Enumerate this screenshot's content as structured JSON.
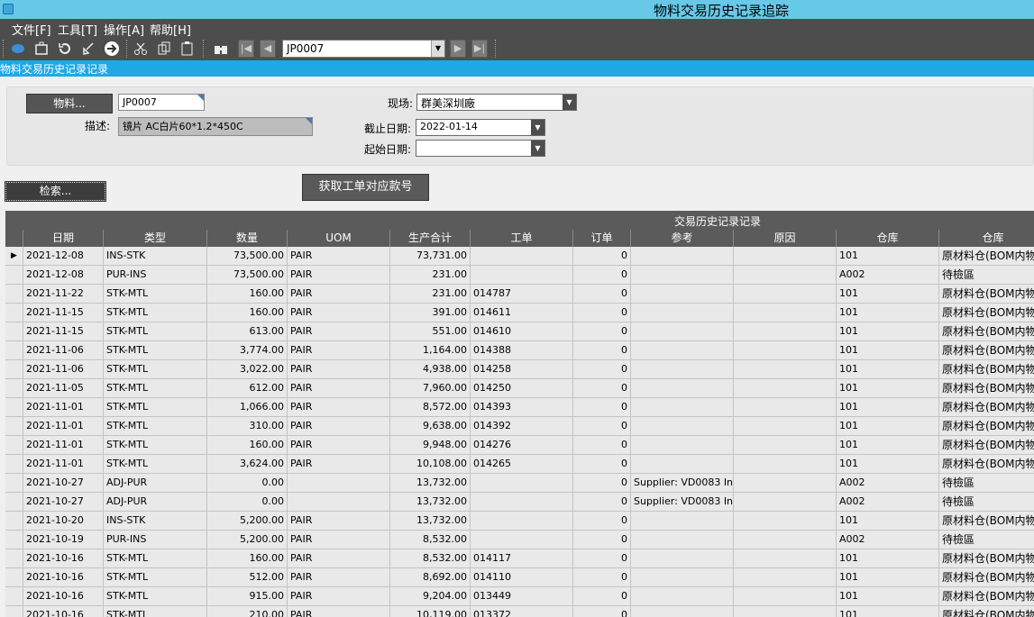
{
  "window": {
    "title": "物料交易历史记录追踪"
  },
  "menu": {
    "file": "文件[F]",
    "tools": "工具[T]",
    "operate": "操作[A]",
    "help": "帮助[H]"
  },
  "toolbar": {
    "combo_value": "JP0007"
  },
  "subtitle": "物料交易历史记录记录",
  "form": {
    "item_button": "物料...",
    "item_value": "JP0007",
    "desc_label": "描述:",
    "desc_value": "镜片 AC白片60*1.2*450C",
    "site_label": "现场:",
    "site_value": "群美深圳廠",
    "end_date_label": "截止日期:",
    "end_date_value": "2022-01-14",
    "start_date_label": "起始日期:",
    "start_date_value": "",
    "get_button": "获取工单对应款号",
    "search_button": "检索..."
  },
  "grid": {
    "title": "交易历史记录记录",
    "columns": [
      "日期",
      "类型",
      "数量",
      "UOM",
      "生产合计",
      "工单",
      "订单",
      "参考",
      "原因",
      "仓库",
      "仓库"
    ],
    "rows": [
      [
        "2021-12-08",
        "INS-STK",
        "73,500.00",
        "PAIR",
        "73,731.00",
        "",
        "0",
        "",
        "",
        "101",
        "原材料仓(BOM内物"
      ],
      [
        "2021-12-08",
        "PUR-INS",
        "73,500.00",
        "PAIR",
        "231.00",
        "",
        "0",
        "",
        "",
        "A002",
        "待檢區"
      ],
      [
        "2021-11-22",
        "STK-MTL",
        "160.00",
        "PAIR",
        "231.00",
        "014787",
        "0",
        "",
        "",
        "101",
        "原材料仓(BOM内物"
      ],
      [
        "2021-11-15",
        "STK-MTL",
        "160.00",
        "PAIR",
        "391.00",
        "014611",
        "0",
        "",
        "",
        "101",
        "原材料仓(BOM内物"
      ],
      [
        "2021-11-15",
        "STK-MTL",
        "613.00",
        "PAIR",
        "551.00",
        "014610",
        "0",
        "",
        "",
        "101",
        "原材料仓(BOM内物"
      ],
      [
        "2021-11-06",
        "STK-MTL",
        "3,774.00",
        "PAIR",
        "1,164.00",
        "014388",
        "0",
        "",
        "",
        "101",
        "原材料仓(BOM内物"
      ],
      [
        "2021-11-06",
        "STK-MTL",
        "3,022.00",
        "PAIR",
        "4,938.00",
        "014258",
        "0",
        "",
        "",
        "101",
        "原材料仓(BOM内物"
      ],
      [
        "2021-11-05",
        "STK-MTL",
        "612.00",
        "PAIR",
        "7,960.00",
        "014250",
        "0",
        "",
        "",
        "101",
        "原材料仓(BOM内物"
      ],
      [
        "2021-11-01",
        "STK-MTL",
        "1,066.00",
        "PAIR",
        "8,572.00",
        "014393",
        "0",
        "",
        "",
        "101",
        "原材料仓(BOM内物"
      ],
      [
        "2021-11-01",
        "STK-MTL",
        "310.00",
        "PAIR",
        "9,638.00",
        "014392",
        "0",
        "",
        "",
        "101",
        "原材料仓(BOM内物"
      ],
      [
        "2021-11-01",
        "STK-MTL",
        "160.00",
        "PAIR",
        "9,948.00",
        "014276",
        "0",
        "",
        "",
        "101",
        "原材料仓(BOM内物"
      ],
      [
        "2021-11-01",
        "STK-MTL",
        "3,624.00",
        "PAIR",
        "10,108.00",
        "014265",
        "0",
        "",
        "",
        "101",
        "原材料仓(BOM内物"
      ],
      [
        "2021-10-27",
        "ADJ-PUR",
        "0.00",
        "",
        "13,732.00",
        "",
        "0",
        "Supplier: VD0083 In",
        "",
        "A002",
        "待檢區"
      ],
      [
        "2021-10-27",
        "ADJ-PUR",
        "0.00",
        "",
        "13,732.00",
        "",
        "0",
        "Supplier: VD0083 In",
        "",
        "A002",
        "待檢區"
      ],
      [
        "2021-10-20",
        "INS-STK",
        "5,200.00",
        "PAIR",
        "13,732.00",
        "",
        "0",
        "",
        "",
        "101",
        "原材料仓(BOM内物"
      ],
      [
        "2021-10-19",
        "PUR-INS",
        "5,200.00",
        "PAIR",
        "8,532.00",
        "",
        "0",
        "",
        "",
        "A002",
        "待檢區"
      ],
      [
        "2021-10-16",
        "STK-MTL",
        "160.00",
        "PAIR",
        "8,532.00",
        "014117",
        "0",
        "",
        "",
        "101",
        "原材料仓(BOM内物"
      ],
      [
        "2021-10-16",
        "STK-MTL",
        "512.00",
        "PAIR",
        "8,692.00",
        "014110",
        "0",
        "",
        "",
        "101",
        "原材料仓(BOM内物"
      ],
      [
        "2021-10-16",
        "STK-MTL",
        "915.00",
        "PAIR",
        "9,204.00",
        "013449",
        "0",
        "",
        "",
        "101",
        "原材料仓(BOM内物"
      ],
      [
        "2021-10-16",
        "STK-MTL",
        "210.00",
        "PAIR",
        "10,119.00",
        "013372",
        "0",
        "",
        "",
        "101",
        "原材料仓(BOM内物"
      ]
    ]
  }
}
